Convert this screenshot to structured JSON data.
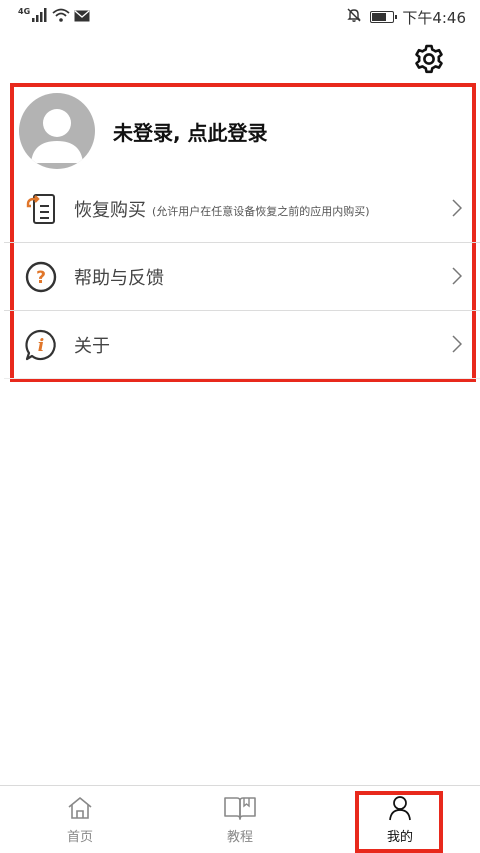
{
  "status_bar": {
    "network": "4G",
    "time": "下午4:46"
  },
  "profile": {
    "login_prompt": "未登录, 点此登录"
  },
  "menu": [
    {
      "label": "恢复购买",
      "note": "(允许用户在任意设备恢复之前的应用内购买)"
    },
    {
      "label": "帮助与反馈",
      "note": ""
    },
    {
      "label": "关于",
      "note": ""
    }
  ],
  "bottom_nav": {
    "items": [
      {
        "label": "首页"
      },
      {
        "label": "教程"
      },
      {
        "label": "我的"
      }
    ],
    "active_index": 2
  },
  "colors": {
    "highlight": "#e8291c",
    "icon_accent": "#e0762a"
  }
}
